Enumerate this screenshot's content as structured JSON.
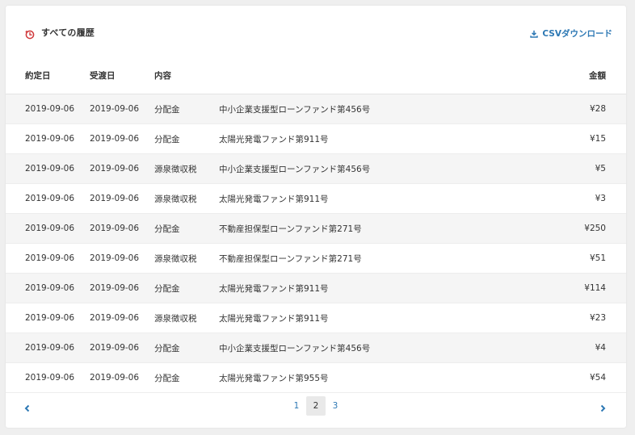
{
  "header": {
    "title": "すべての履歴",
    "csv_label": "CSVダウンロード"
  },
  "colors": {
    "accent": "#2d78b4",
    "clock_icon": "#d0383a"
  },
  "table": {
    "columns": [
      "約定日",
      "受渡日",
      "内容",
      "",
      "金額"
    ],
    "rows": [
      [
        "2019-09-06",
        "2019-09-06",
        "分配金",
        "中小企業支援型ローンファンド第456号",
        "¥28"
      ],
      [
        "2019-09-06",
        "2019-09-06",
        "分配金",
        "太陽光発電ファンド第911号",
        "¥15"
      ],
      [
        "2019-09-06",
        "2019-09-06",
        "源泉徴収税",
        "中小企業支援型ローンファンド第456号",
        "¥5"
      ],
      [
        "2019-09-06",
        "2019-09-06",
        "源泉徴収税",
        "太陽光発電ファンド第911号",
        "¥3"
      ],
      [
        "2019-09-06",
        "2019-09-06",
        "分配金",
        "不動産担保型ローンファンド第271号",
        "¥250"
      ],
      [
        "2019-09-06",
        "2019-09-06",
        "源泉徴収税",
        "不動産担保型ローンファンド第271号",
        "¥51"
      ],
      [
        "2019-09-06",
        "2019-09-06",
        "分配金",
        "太陽光発電ファンド第911号",
        "¥114"
      ],
      [
        "2019-09-06",
        "2019-09-06",
        "源泉徴収税",
        "太陽光発電ファンド第911号",
        "¥23"
      ],
      [
        "2019-09-06",
        "2019-09-06",
        "分配金",
        "中小企業支援型ローンファンド第456号",
        "¥4"
      ],
      [
        "2019-09-06",
        "2019-09-06",
        "分配金",
        "太陽光発電ファンド第955号",
        "¥54"
      ]
    ]
  },
  "pagination": {
    "pages": [
      "1",
      "2",
      "3"
    ],
    "current": "2"
  }
}
